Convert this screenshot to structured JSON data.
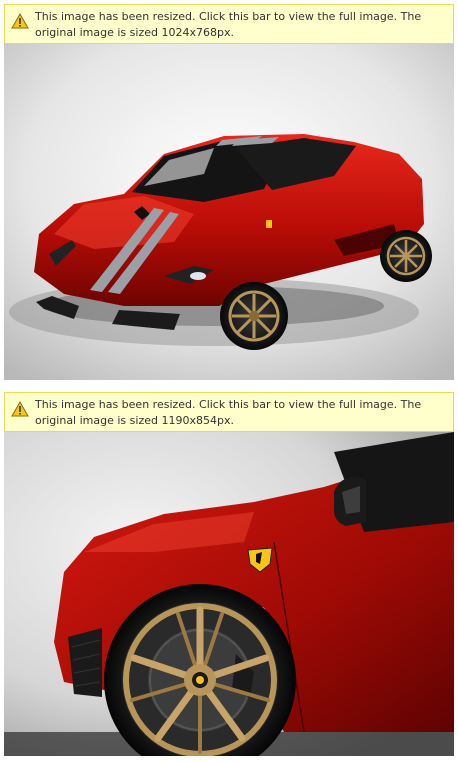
{
  "images": [
    {
      "notice": "This image has been resized. Click this bar to view the full image. The original image is sized 1024x768px.",
      "alt": "Red Ferrari F430 Scuderia with silver racing stripes, front three-quarter view"
    },
    {
      "notice": "This image has been resized. Click this bar to view the full image. The original image is sized 1190x854px.",
      "alt": "Close-up of red Ferrari front fender with gold wheel and Ferrari badge"
    }
  ],
  "colors": {
    "bar_bg": "#ffffcc",
    "bar_border": "#e6db55",
    "icon_yellow": "#f5c518",
    "car_red": "#c8100a",
    "wheel_gold": "#b8965a"
  },
  "icons": {
    "warning": "warning-icon"
  }
}
